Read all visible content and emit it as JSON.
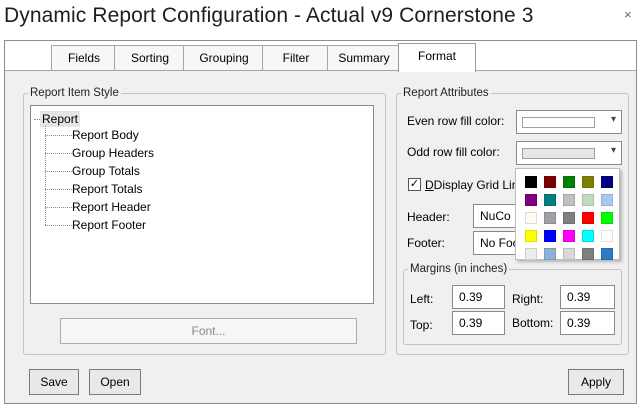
{
  "window": {
    "title": "Dynamic Report Configuration - Actual v9 Cornerstone 3",
    "close_glyph": "×"
  },
  "tabs": [
    {
      "label": "Fields"
    },
    {
      "label": "Sorting"
    },
    {
      "label": "Grouping"
    },
    {
      "label": "Filter"
    },
    {
      "label": "Summary"
    },
    {
      "label": "Format",
      "active": true
    }
  ],
  "report_item_style": {
    "legend": "Report Item Style",
    "root": "Report",
    "children": [
      "Report Body",
      "Group Headers",
      "Group Totals",
      "Report Totals",
      "Report Header",
      "Report Footer"
    ],
    "font_button": "Font..."
  },
  "report_attributes": {
    "legend": "Report Attributes",
    "even_row_label": "Even row fill color:",
    "even_row_color": "#ffffff",
    "odd_row_label": "Odd row fill color:",
    "odd_row_color": "#e6e6e6",
    "display_grid_lines_label": "Display Grid Lines",
    "display_grid_lines_checked": true,
    "header_label": "Header:",
    "header_value": "NuCo L",
    "footer_label": "Footer:",
    "footer_value": "No Foo",
    "palette_colors": [
      [
        "#000000",
        "#800000",
        "#008000",
        "#808000",
        "#000080"
      ],
      [
        "#800080",
        "#008080",
        "#c0c0c0",
        "#c0dcc0",
        "#a6caf0"
      ],
      [
        "#fffbf0",
        "#a0a0a4",
        "#808080",
        "#ff0000",
        "#00ff00"
      ],
      [
        "#ffff00",
        "#0000ff",
        "#ff00ff",
        "#00ffff",
        "#ffffff"
      ],
      [
        "#ececec",
        "#8fb0d8",
        "#d9d9d9",
        "#7f7f7f",
        "#2e7bc4"
      ]
    ],
    "margins": {
      "legend": "Margins (in inches)",
      "left_label": "Left:",
      "left_value": "0.39",
      "right_label": "Right:",
      "right_value": "0.39",
      "top_label": "Top:",
      "top_value": "0.39",
      "bottom_label": "Bottom:",
      "bottom_value": "0.39"
    }
  },
  "buttons": {
    "save": "Save",
    "open": "Open",
    "apply": "Apply"
  }
}
